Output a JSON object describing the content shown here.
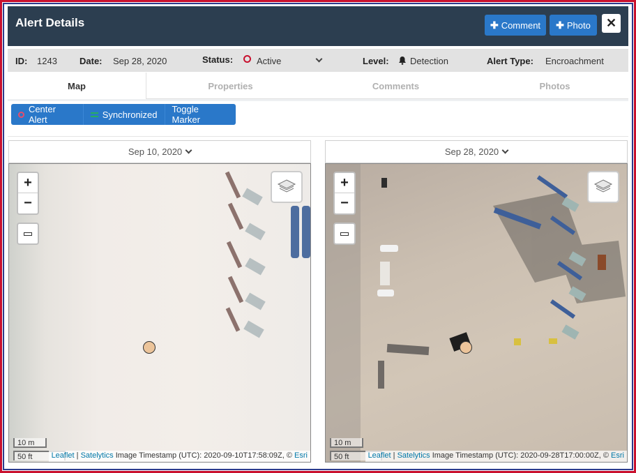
{
  "header": {
    "title": "Alert Details",
    "comment_label": "Comment",
    "photo_label": "Photo",
    "close_glyph": "✕"
  },
  "info": {
    "id_label": "ID:",
    "id_value": "1243",
    "date_label": "Date:",
    "date_value": "Sep 28, 2020",
    "status_label": "Status:",
    "status_value": "Active",
    "level_label": "Level:",
    "level_value": "Detection",
    "type_label": "Alert Type:",
    "type_value": "Encroachment"
  },
  "tabs": [
    {
      "label": "Map",
      "active": true
    },
    {
      "label": "Properties",
      "active": false
    },
    {
      "label": "Comments",
      "active": false
    },
    {
      "label": "Photos",
      "active": false
    }
  ],
  "toolbar": {
    "center_alert": "Center Alert",
    "synchronized": "Synchronized",
    "toggle_marker": "Toggle Marker"
  },
  "maps": {
    "left": {
      "date": "Sep 10, 2020",
      "scale_m": "10 m",
      "scale_ft": "50 ft",
      "attr_leaflet": "Leaflet",
      "attr_sep": " | ",
      "attr_satelytics": "Satelytics",
      "attr_rest": " Image Timestamp (UTC): 2020-09-10T17:58:09Z, © ",
      "attr_esri": "Esri"
    },
    "right": {
      "date": "Sep 28, 2020",
      "scale_m": "10 m",
      "scale_ft": "50 ft",
      "attr_leaflet": "Leaflet",
      "attr_sep": " | ",
      "attr_satelytics": "Satelytics",
      "attr_rest": " Image Timestamp (UTC): 2020-09-28T17:00:00Z, © ",
      "attr_esri": "Esri"
    }
  },
  "zoom": {
    "plus": "+",
    "minus": "−"
  },
  "colors": {
    "header_bg": "#2c3e50",
    "accent": "#2a78c9",
    "status_red": "#c8102e",
    "marker": "#ecc49a"
  },
  "icons": {
    "comment": "plus-icon",
    "photo": "plus-icon",
    "close": "close-icon",
    "status": "circle-icon",
    "level": "bell-icon",
    "layers": "layers-icon",
    "ruler": "ruler-icon"
  }
}
